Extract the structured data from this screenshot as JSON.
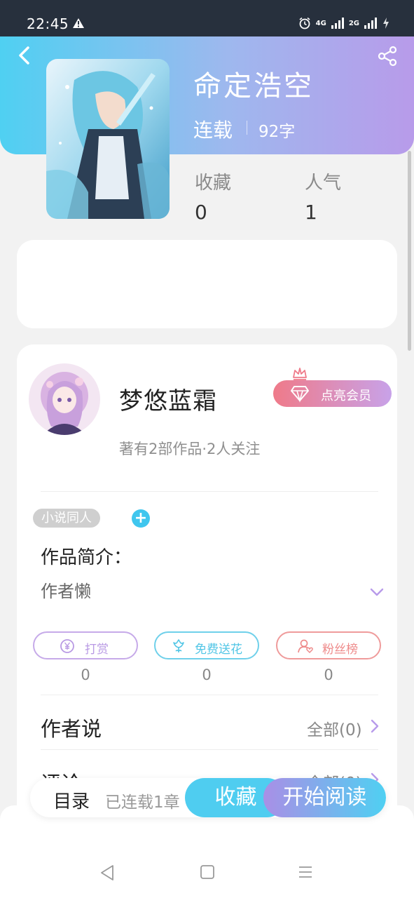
{
  "status_bar": {
    "time": "22:45",
    "net_4g": "4G",
    "net_2g": "2G"
  },
  "book": {
    "title": "命定浩空",
    "status": "连载",
    "word_count": "92字",
    "stats": [
      {
        "label": "收藏",
        "value": "0"
      },
      {
        "label": "人气",
        "value": "1"
      }
    ]
  },
  "author": {
    "name": "梦悠蓝霜",
    "vip_label": "点亮会员",
    "meta": "著有2部作品·2人关注"
  },
  "tags": {
    "items": [
      "小说同人"
    ],
    "add_symbol": "+"
  },
  "intro": {
    "label": "作品简介：",
    "text": "作者懒"
  },
  "actions": [
    {
      "label": "打赏",
      "count": "0",
      "color": "#b99ae4",
      "icon": "yen-coin-icon"
    },
    {
      "label": "免费送花",
      "count": "0",
      "color": "#52c6e6",
      "icon": "flower-icon"
    },
    {
      "label": "粉丝榜",
      "count": "0",
      "color": "#ee8a8a",
      "icon": "fan-user-icon"
    }
  ],
  "sections": [
    {
      "title": "作者说",
      "more": "全部(0)"
    },
    {
      "title": "评论",
      "more": "全部(0)"
    }
  ],
  "bottom_bar": {
    "toc_label": "目录",
    "toc_progress": "已连载1章",
    "favorite_label": "收藏",
    "read_label": "开始阅读"
  },
  "colors": {
    "accent_cyan": "#4fcdf0",
    "accent_purple": "#b89bea",
    "vip_pink": "#ef7a89"
  }
}
